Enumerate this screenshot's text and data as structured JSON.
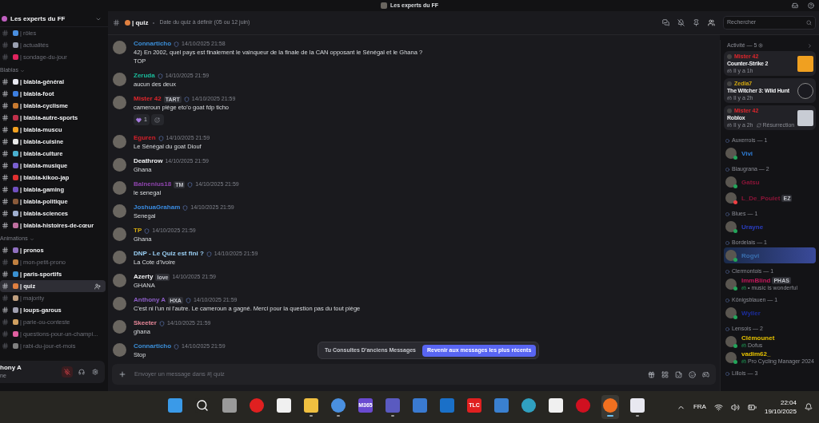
{
  "window": {
    "title": "Les experts du FF"
  },
  "server": {
    "name": "Les experts du FF"
  },
  "channel_groups": [
    {
      "channels": [
        {
          "name": "| rôles",
          "unread": false,
          "selected": false
        },
        {
          "name": "| actualités",
          "unread": false,
          "selected": false
        },
        {
          "name": "| sondage-du-jour",
          "unread": false,
          "selected": false
        }
      ]
    },
    {
      "category": "Blablas",
      "channels": [
        {
          "name": "| blabla-général",
          "unread": true,
          "selected": false
        },
        {
          "name": "| blabla-foot",
          "unread": true,
          "selected": false
        },
        {
          "name": "| blabla-cyclisme",
          "unread": true,
          "selected": false
        },
        {
          "name": "| blabla-autre-sports",
          "unread": true,
          "selected": false
        },
        {
          "name": "| blabla-muscu",
          "unread": true,
          "selected": false
        },
        {
          "name": "| blabla-cuisine",
          "unread": true,
          "selected": false
        },
        {
          "name": "| blabla-culture",
          "unread": true,
          "selected": false
        },
        {
          "name": "| blabla-musique",
          "unread": true,
          "selected": false
        },
        {
          "name": "| blabla-kikoo-jap",
          "unread": true,
          "selected": false
        },
        {
          "name": "| blabla-gaming",
          "unread": true,
          "selected": false
        },
        {
          "name": "| blabla-politique",
          "unread": true,
          "selected": false
        },
        {
          "name": "| blabla-sciences",
          "unread": true,
          "selected": false
        },
        {
          "name": "| blabla-histoires-de-cœur",
          "unread": true,
          "selected": false
        }
      ]
    },
    {
      "category": "Animations",
      "channels": [
        {
          "name": "| pronos",
          "unread": true,
          "selected": false
        },
        {
          "name": "| mon-petit-prono",
          "unread": false,
          "selected": false
        },
        {
          "name": "| paris-sportifs",
          "unread": true,
          "selected": false
        },
        {
          "name": "| quiz",
          "unread": true,
          "selected": true
        },
        {
          "name": "| majority",
          "unread": false,
          "selected": false
        },
        {
          "name": "| loups-garous",
          "unread": true,
          "selected": false
        },
        {
          "name": "| parie-ou-conteste",
          "unread": false,
          "selected": false
        },
        {
          "name": "| questions-pour-un-champi...",
          "unread": false,
          "selected": false
        },
        {
          "name": "| rabi-du-jour-et-mois",
          "unread": false,
          "selected": false
        }
      ]
    }
  ],
  "user_panel": {
    "name": "hony A",
    "status": "ne",
    "muted": true
  },
  "channel_header": {
    "name": "| quiz",
    "topic": "Date du quiz à définir (05 ou 12 juin)"
  },
  "search": {
    "placeholder": "Rechercher"
  },
  "messages": [
    {
      "author": "Connarticho",
      "color": "#3b8fd9",
      "role_icon": true,
      "time": "14/10/2025 21:58",
      "lines": [
        "42) En 2002, quel pays est finalement le vainqueur de la finale de la CAN opposant le Sénégal et le Ghana ?",
        "TOP"
      ]
    },
    {
      "author": "Zeruda",
      "color": "#1abc9c",
      "role_icon": true,
      "time": "14/10/2025 21:59",
      "lines": [
        "aucun des deux"
      ]
    },
    {
      "author": "Mister 42",
      "color": "#e0262c",
      "tag": "TART",
      "role_icon": true,
      "time": "14/10/2025 21:59",
      "lines": [
        "cameroun piège eto'o goat fdp ticho"
      ],
      "reactions": [
        {
          "count": "1"
        }
      ]
    },
    {
      "author": "Eguren",
      "color": "#d4202a",
      "role_icon": true,
      "time": "14/10/2025 21:59",
      "lines": [
        "Le Sénégal du goat Diouf"
      ]
    },
    {
      "author": "Deathrow",
      "color": "#f2f3f5",
      "role_icon": false,
      "time": "14/10/2025 21:59",
      "lines": [
        "Ghana"
      ]
    },
    {
      "author": "Balnenius18",
      "color": "#8e44ad",
      "tag": "TM",
      "role_icon": true,
      "time": "14/10/2025 21:59",
      "lines": [
        "le senegal"
      ]
    },
    {
      "author": "JoshuaGraham",
      "color": "#3a8be0",
      "role_icon": true,
      "time": "14/10/2025 21:59",
      "lines": [
        "Senegal"
      ]
    },
    {
      "author": "TP",
      "color": "#d4a90f",
      "role_icon": true,
      "time": "14/10/2025 21:59",
      "lines": [
        "Ghana"
      ]
    },
    {
      "author": "DNP - Le Quiz est fini ?",
      "color": "#9bd0f5",
      "role_icon": true,
      "time": "14/10/2025 21:59",
      "lines": [
        "La Cote d'Ivoire"
      ]
    },
    {
      "author": "Azerty",
      "color": "#f2f3f5",
      "tag": "love",
      "role_icon": false,
      "time": "14/10/2025 21:59",
      "lines": [
        "GHANA"
      ]
    },
    {
      "author": "Anthony A",
      "color": "#8e5ec9",
      "tag": "HXA",
      "role_icon": true,
      "time": "14/10/2025 21:59",
      "lines": [
        "C'est ni l'un ni l'autre. Le cameroun a gagné. Merci pour la question pas du tout piège"
      ]
    },
    {
      "author": "Skeeter",
      "color": "#e8889a",
      "role_icon": true,
      "time": "14/10/2025 21:59",
      "lines": [
        "ghana"
      ]
    },
    {
      "author": "Connarticho",
      "color": "#3b8fd9",
      "role_icon": true,
      "time": "14/10/2025 21:59",
      "lines": [
        "Stop"
      ]
    }
  ],
  "old_messages_notice": {
    "text": "Tu Consultes D'anciens Messages",
    "button": "Revenir aux messages les plus récents"
  },
  "composer": {
    "placeholder": "Envoyer un message dans #| quiz"
  },
  "activity": {
    "title": "Activité — 5",
    "cards": [
      {
        "user": "Mister 42",
        "color": "#e0262c",
        "game": "Counter-Strike 2",
        "time": "Il y a 1h"
      },
      {
        "user": "Zedla7",
        "color": "#d4a90f",
        "game": "The Witcher 3: Wild Hunt",
        "time": "Il y a 2h"
      },
      {
        "user": "Mister 42",
        "color": "#e0262c",
        "game": "Roblox",
        "time": "Il y a 2h",
        "extra": "Résurrection"
      }
    ]
  },
  "member_groups": [
    {
      "name": "Auxerrois — 1",
      "members": [
        {
          "name": "Vivi",
          "color": "#2f7fd8",
          "dnd": false,
          "highlighted": false
        }
      ]
    },
    {
      "name": "Blaugrana — 2",
      "members": [
        {
          "name": "Gatsu",
          "color": "#8b1538",
          "dnd": false,
          "highlighted": false
        },
        {
          "name": "L_De_Poulet",
          "color": "#8b1538",
          "dnd": true,
          "tag": "EZ",
          "highlighted": false
        }
      ]
    },
    {
      "name": "Blues — 1",
      "members": [
        {
          "name": "Urayne",
          "color": "#2a3ec0",
          "dnd": false,
          "highlighted": false
        }
      ]
    },
    {
      "name": "Bordelais — 1",
      "members": [
        {
          "name": "Rogvi",
          "color": "#3a6fb0",
          "dnd": false,
          "highlighted": true
        }
      ]
    },
    {
      "name": "Clermontois — 1",
      "members": [
        {
          "name": "ImmBlind",
          "color": "#c2185b",
          "dnd": false,
          "tag": "PHAS",
          "activity": "• music is wonderful",
          "highlighted": false
        }
      ]
    },
    {
      "name": "Königsblauen — 1",
      "members": [
        {
          "name": "Wyller",
          "color": "#1c2d9c",
          "dnd": false,
          "highlighted": false
        }
      ]
    },
    {
      "name": "Lensois — 2",
      "members": [
        {
          "name": "Clémounet",
          "color": "#e6c200",
          "dnd": false,
          "activity": "Dofus",
          "highlighted": false
        },
        {
          "name": "vadim62_",
          "color": "#e6c200",
          "dnd": false,
          "activity": "Pro Cycling Manager 2024",
          "highlighted": false
        }
      ]
    },
    {
      "name": "Lillois — 3"
    }
  ],
  "taskbar": {
    "apps": [
      {
        "kind": "start",
        "running": false,
        "selected": false
      },
      {
        "kind": "search",
        "running": false,
        "selected": false
      },
      {
        "kind": "taskview",
        "running": false,
        "selected": false
      },
      {
        "kind": "record",
        "running": false,
        "selected": false
      },
      {
        "kind": "file",
        "running": false,
        "selected": false
      },
      {
        "kind": "folder",
        "running": true,
        "selected": false
      },
      {
        "kind": "chrome",
        "running": true,
        "selected": false
      },
      {
        "kind": "m365",
        "label": "M365",
        "running": false,
        "selected": false
      },
      {
        "kind": "teams",
        "running": true,
        "selected": false
      },
      {
        "kind": "tile",
        "running": false,
        "selected": false
      },
      {
        "kind": "outlook",
        "running": false,
        "selected": false
      },
      {
        "kind": "tlc",
        "label": "TLC",
        "running": false,
        "selected": false
      },
      {
        "kind": "store",
        "running": false,
        "selected": false
      },
      {
        "kind": "edge",
        "running": false,
        "selected": false
      },
      {
        "kind": "file",
        "running": false,
        "selected": false
      },
      {
        "kind": "opera",
        "running": false,
        "selected": false
      },
      {
        "kind": "firefox",
        "running": true,
        "selected": true
      },
      {
        "kind": "doc",
        "running": true,
        "selected": false
      }
    ],
    "language": "FRA",
    "time": "22:04",
    "date": "19/10/2025"
  }
}
